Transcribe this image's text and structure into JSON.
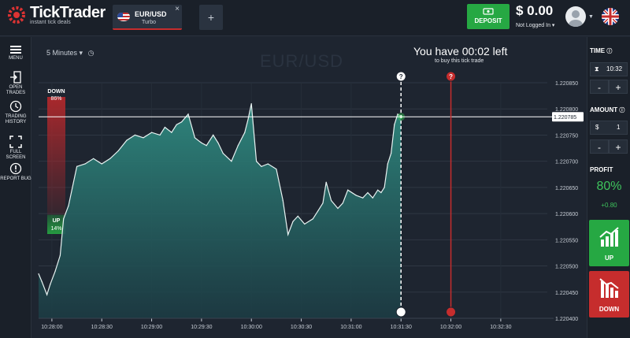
{
  "app": {
    "name": "TickTrader",
    "tagline": "instant tick deals"
  },
  "tabs": [
    {
      "asset": "EUR/USD",
      "type": "Turbo",
      "close": "×"
    }
  ],
  "add_tab": "+",
  "deposit": {
    "label": "DEPOSIT"
  },
  "account": {
    "balance": "$ 0.00",
    "status": "Not Logged In ▾"
  },
  "nav": [
    {
      "id": "menu",
      "label": "MENU",
      "icon": "hamburger-icon"
    },
    {
      "id": "open-trades",
      "label": "OPEN TRADES",
      "icon": "open-trades-icon"
    },
    {
      "id": "trading-history",
      "label": "TRADING HISTORY",
      "icon": "history-icon"
    },
    {
      "id": "full-screen",
      "label": "FULL SCREEN",
      "icon": "fullscreen-icon"
    },
    {
      "id": "report-bug",
      "label": "REPORT BUG",
      "icon": "report-bug-icon"
    }
  ],
  "chart": {
    "timeframe": "5 Minutes ▾",
    "symbol_watermark": "EUR/USD",
    "timer": {
      "title": "You have 00:02 left",
      "subtitle": "to buy this tick trade"
    },
    "current_price": "1.220785",
    "sentiment": {
      "down_label": "DOWN",
      "down_pct": "86%",
      "up_label": "UP",
      "up_pct": "14%",
      "down_value": 86,
      "up_value": 14
    }
  },
  "chart_data": {
    "type": "area",
    "title": "EUR/USD",
    "x_ticks": [
      "10:28:00",
      "10:28:30",
      "10:29:00",
      "10:29:30",
      "10:30:00",
      "10:30:30",
      "10:31:00",
      "10:31:30",
      "10:32:00",
      "10:32:30"
    ],
    "y_ticks": [
      "1.220850",
      "1.220800",
      "1.220750",
      "1.220700",
      "1.220650",
      "1.220600",
      "1.220550",
      "1.220500",
      "1.220450",
      "1.220400"
    ],
    "ylim": [
      1.2204,
      1.22085
    ],
    "xlim": [
      "10:27:52",
      "10:32:58"
    ],
    "series": [
      {
        "x": [
          "10:27:52",
          "10:27:54",
          "10:27:57",
          "10:27:59",
          "10:28:02",
          "10:28:05",
          "10:28:07",
          "10:28:10",
          "10:28:15",
          "10:28:20",
          "10:28:25",
          "10:28:30",
          "10:28:35",
          "10:28:40",
          "10:28:45",
          "10:28:50",
          "10:28:55",
          "10:29:00",
          "10:29:05",
          "10:29:08",
          "10:29:12",
          "10:29:15",
          "10:29:18",
          "10:29:22",
          "10:29:26",
          "10:29:30",
          "10:29:33",
          "10:29:37",
          "10:29:40",
          "10:29:43",
          "10:29:48",
          "10:29:52",
          "10:29:56",
          "10:29:58",
          "10:30:00",
          "10:30:03",
          "10:30:06",
          "10:30:10",
          "10:30:15",
          "10:30:19",
          "10:30:22",
          "10:30:25",
          "10:30:28",
          "10:30:32",
          "10:30:37",
          "10:30:40",
          "10:30:43",
          "10:30:45",
          "10:30:48",
          "10:30:52",
          "10:30:55",
          "10:30:58",
          "10:31:03",
          "10:31:07",
          "10:31:10",
          "10:31:13",
          "10:31:16",
          "10:31:18",
          "10:31:20",
          "10:31:22",
          "10:31:24",
          "10:31:26",
          "10:31:28",
          "10:31:30"
        ],
        "y": [
          1.220485,
          1.22047,
          1.220445,
          1.220465,
          1.22049,
          1.22052,
          1.22059,
          1.220615,
          1.22069,
          1.220695,
          1.220705,
          1.220695,
          1.220705,
          1.22072,
          1.22074,
          1.22075,
          1.220745,
          1.220755,
          1.22075,
          1.220765,
          1.220755,
          1.22077,
          1.220775,
          1.22079,
          1.220745,
          1.220735,
          1.22073,
          1.22075,
          1.220735,
          1.220715,
          1.2207,
          1.22073,
          1.220755,
          1.22078,
          1.22081,
          1.2207,
          1.22069,
          1.220695,
          1.220685,
          1.220625,
          1.22056,
          1.220585,
          1.220595,
          1.22058,
          1.22059,
          1.220605,
          1.22062,
          1.22066,
          1.220625,
          1.22061,
          1.22062,
          1.220645,
          1.220635,
          1.22063,
          1.22064,
          1.22063,
          1.220645,
          1.22064,
          1.22065,
          1.220695,
          1.220715,
          1.22077,
          1.22079,
          1.220785
        ]
      }
    ],
    "markers": [
      {
        "time": "10:31:30",
        "kind": "purchase deadline",
        "icon": "question-icon",
        "color": "#ffffff"
      },
      {
        "time": "10:32:00",
        "kind": "expiry",
        "icon": "question-icon",
        "color": "#c62d2d"
      }
    ],
    "grid": true
  },
  "colors": {
    "accent_green": "#26a843",
    "accent_red": "#c62d2d",
    "area_fill": "#2f8a80",
    "line": "#e8f3f2",
    "bg": "#1e2530"
  },
  "trade": {
    "time_label": "TIME",
    "time_value": "10:32",
    "amount_label": "AMOUNT",
    "amount_currency": "$",
    "amount_value": "1",
    "minus": "-",
    "plus": "+",
    "profit_label": "PROFIT",
    "profit_pct": "80%",
    "profit_amt": "+0.80",
    "up_label": "UP",
    "down_label": "DOWN"
  }
}
